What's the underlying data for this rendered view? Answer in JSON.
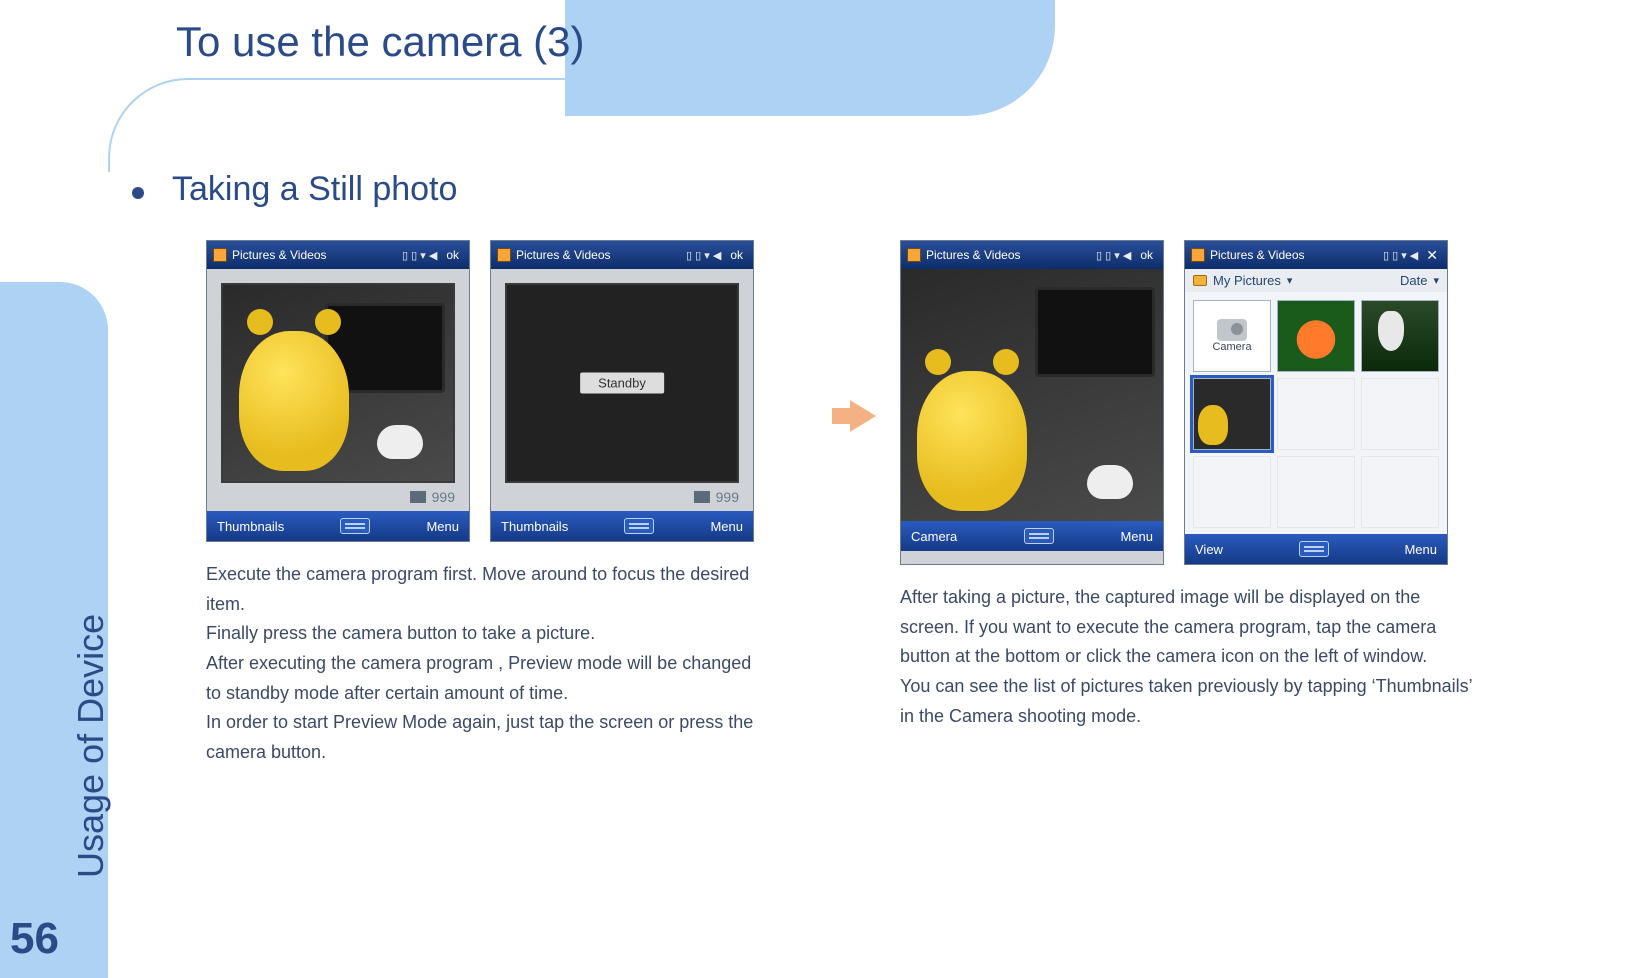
{
  "header": {
    "title": "To use the camera (3)"
  },
  "sidebar": {
    "section_label": "Usage of Device",
    "page_number": "56"
  },
  "subtitle": "Taking a Still photo",
  "phone_common": {
    "titlebar": "Pictures & Videos",
    "ok": "ok",
    "close": "✕",
    "signal_glyphs": "▯ ▯  ▾  ◀",
    "counter": "999"
  },
  "screens": {
    "preview": {
      "soft_left": "Thumbnails",
      "soft_right": "Menu"
    },
    "standby": {
      "label": "Standby",
      "soft_left": "Thumbnails",
      "soft_right": "Menu"
    },
    "captured": {
      "soft_left": "Camera",
      "soft_right": "Menu"
    },
    "gallery": {
      "folder_label": "My Pictures",
      "sort_label": "Date",
      "camera_cell_label": "Camera",
      "soft_left": "View",
      "soft_right": "Menu"
    }
  },
  "descriptions": {
    "left": "Execute  the camera program first. Move around to focus the desired item.\nFinally press the camera button to take a picture.\nAfter executing the camera program , Preview mode will be changed to standby mode after certain amount of time.\nIn order to start Preview Mode again, just tap the screen or press the camera button.",
    "right": "After taking a picture, the captured image will be displayed on the screen. If you want to execute the camera program, tap the camera button at the bottom or click the camera icon on the left of window.\nYou can see the list of pictures taken previously by tapping ‘Thumbnails’ in the Camera shooting mode."
  }
}
